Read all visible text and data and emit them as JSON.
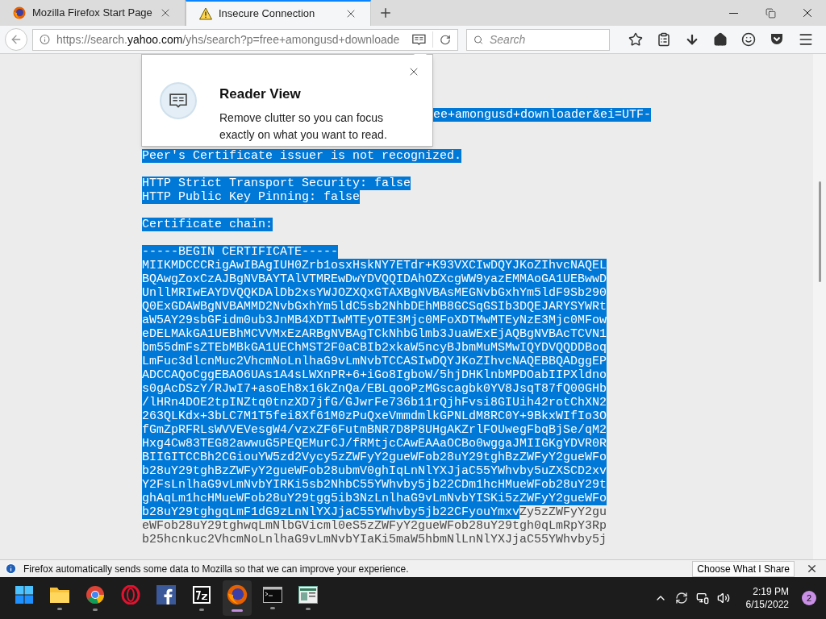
{
  "tabs": [
    {
      "title": "Mozilla Firefox Start Page",
      "kind": "firefox",
      "selected": false
    },
    {
      "title": "Insecure Connection",
      "kind": "warning",
      "selected": true
    }
  ],
  "address_bar": {
    "url_prefix": "https://search.",
    "url_domain": "yahoo.com",
    "url_rest": "/yhs/search?p=free+amongusd+downloade"
  },
  "search": {
    "placeholder": "Search"
  },
  "reader_view_popup": {
    "title": "Reader View",
    "text": "Remove clutter so you can focus exactly on what you want to read."
  },
  "page": {
    "lines": [
      {
        "kind": "tail",
        "parts": [
          {
            "text": "ee+amongusd+downloader&ei=UTF-",
            "selected": true
          }
        ]
      },
      {
        "kind": "blank"
      },
      {
        "kind": "blank"
      },
      {
        "kind": "text",
        "parts": [
          {
            "text": "Peer's Certificate issuer is not recognized.",
            "selected": true
          }
        ]
      },
      {
        "kind": "blank"
      },
      {
        "kind": "text",
        "parts": [
          {
            "text": "HTTP Strict Transport Security: false",
            "selected": true
          }
        ]
      },
      {
        "kind": "text",
        "parts": [
          {
            "text": "HTTP Public Key Pinning: false",
            "selected": true
          }
        ]
      },
      {
        "kind": "blank"
      },
      {
        "kind": "text",
        "parts": [
          {
            "text": "Certificate chain:",
            "selected": true
          }
        ]
      },
      {
        "kind": "blank"
      },
      {
        "kind": "text",
        "parts": [
          {
            "text": "-----BEGIN CERTIFICATE-----",
            "selected": true
          }
        ]
      },
      {
        "kind": "text",
        "parts": [
          {
            "text": "MIIKMDCCCRigAwIBAgIUH0Zrb1osxHskNY7ETdr+K93VXCIwDQYJKoZIhvcNAQEL",
            "selected": true
          }
        ]
      },
      {
        "kind": "text",
        "parts": [
          {
            "text": "BQAwgZoxCzAJBgNVBAYTAlVTMREwDwYDVQQIDAhOZXcgWW9yazEMMAoGA1UEBwwD",
            "selected": true
          }
        ]
      },
      {
        "kind": "text",
        "parts": [
          {
            "text": "UnllMRIwEAYDVQQKDAlDb2xsYWJOZXQxGTAXBgNVBAsMEGNvbGxhYm5ldF9Sb290",
            "selected": true
          }
        ]
      },
      {
        "kind": "text",
        "parts": [
          {
            "text": "Q0ExGDAWBgNVBAMMD2NvbGxhYm5ldC5sb2NhbDEhMB8GCSqGSIb3DQEJARYSYWRt",
            "selected": true
          }
        ]
      },
      {
        "kind": "text",
        "parts": [
          {
            "text": "aW5AY29sbGFidm0ub3JnMB4XDTIwMTEyOTE3Mjc0MFoXDTMwMTEyNzE3Mjc0MFow",
            "selected": true
          }
        ]
      },
      {
        "kind": "text",
        "parts": [
          {
            "text": "eDELMAkGA1UEBhMCVVMxEzARBgNVBAgTCkNhbGlmb3JuaWExEjAQBgNVBAcTCVN1",
            "selected": true
          }
        ]
      },
      {
        "kind": "text",
        "parts": [
          {
            "text": "bm55dmFsZTEbMBkGA1UEChMST2F0aCBIb2xkaW5ncyBJbmMuMSMwIQYDVQQDDBoq",
            "selected": true
          }
        ]
      },
      {
        "kind": "text",
        "parts": [
          {
            "text": "LmFuc3dlcnMuc2VhcmNoLnlhaG9vLmNvbTCCASIwDQYJKoZIhvcNAQEBBQADggEP",
            "selected": true
          }
        ]
      },
      {
        "kind": "text",
        "parts": [
          {
            "text": "ADCCAQoCggEBAO6UAs1A4sLWXnPR+6+iGo8IgboW/5hjDHKlnbMPDOabIIPXldno",
            "selected": true
          }
        ]
      },
      {
        "kind": "text",
        "parts": [
          {
            "text": "s0gAcDSzY/RJwI7+asoEh8x16kZnQa/EBLqooPzMGscagbk0YV8JsqT87fQ00GHb",
            "selected": true
          }
        ]
      },
      {
        "kind": "text",
        "parts": [
          {
            "text": "/lHRn4DOE2tpINZtq0tnzXD7jfG/GJwrFe736b11rQjhFvsi8GIUih42rotChXN2",
            "selected": true
          }
        ]
      },
      {
        "kind": "text",
        "parts": [
          {
            "text": "263QLKdx+3bLC7M1T5fei8Xf61M0zPuQxeVmmdmlkGPNLdM8RC0Y+9BkxWIfIo3O",
            "selected": true
          }
        ]
      },
      {
        "kind": "text",
        "parts": [
          {
            "text": "fGmZpRFRLsWVVEVesgW4/vzxZF6FutmBNR7D8P8UHgAKZrlFOUwegFbqBjSe/qM2",
            "selected": true
          }
        ]
      },
      {
        "kind": "text",
        "parts": [
          {
            "text": "Hxg4Cw83TEG82awwuG5PEQEMurCJ/fRMtjcCAwEAAaOCBo0wggaJMIIGKgYDVR0R",
            "selected": true
          }
        ]
      },
      {
        "kind": "text",
        "parts": [
          {
            "text": "BIIGITCCBh2CGiouYW5zd2Vycy5zZWFyY2gueWFob28uY29tghBzZWFyY2gueWFo",
            "selected": true
          }
        ]
      },
      {
        "kind": "text",
        "parts": [
          {
            "text": "b28uY29tghBzZWFyY2gueWFob28ubmV0ghIqLnNlYXJjaC55YWhvby5uZXSCD2xv",
            "selected": true
          }
        ]
      },
      {
        "kind": "text",
        "parts": [
          {
            "text": "Y2FsLnlhaG9vLmNvbYIRKi5sb2NhbC55YWhvby5jb22CDm1hcHMueWFob28uY29t",
            "selected": true
          }
        ]
      },
      {
        "kind": "text",
        "parts": [
          {
            "text": "ghAqLm1hcHMueWFob28uY29tgg5ib3NzLnlhaG9vLmNvbYISKi5zZWFyY2gueWFo",
            "selected": true
          }
        ]
      },
      {
        "kind": "text",
        "parts": [
          {
            "text": "b28uY29tghgqLmF1dG9zLnNlYXJjaC55YWhvby5jb22CFyouYmxv",
            "selected": true
          },
          {
            "text": "Zy5zZWFyY2gu",
            "selected": false
          }
        ]
      },
      {
        "kind": "text",
        "parts": [
          {
            "text": "eWFob28uY29tghwqLmNlbGVicml0eS5zZWFyY2gueWFob28uY29tgh0qLmRpY3Rp",
            "selected": false
          }
        ]
      },
      {
        "kind": "text",
        "parts": [
          {
            "text": "b25hcnkuc2VhcmNoLnlhaG9vLmNvbYIaKi5maW5hbmNlLnNlYXJjaC55YWhvby5j",
            "selected": false
          }
        ]
      }
    ]
  },
  "notification": {
    "text": "Firefox automatically sends some data to Mozilla so that we can improve your experience.",
    "button": "Choose What I Share"
  },
  "taskbar": {
    "apps": [
      {
        "kind": "start",
        "running": false,
        "selected": false
      },
      {
        "kind": "folder",
        "running": true,
        "selected": false
      },
      {
        "kind": "chrome",
        "running": true,
        "selected": false
      },
      {
        "kind": "opera",
        "running": false,
        "selected": false
      },
      {
        "kind": "facebook",
        "running": false,
        "selected": false
      },
      {
        "kind": "sevenzip",
        "running": true,
        "selected": false
      },
      {
        "kind": "firefox",
        "running": true,
        "selected": true
      },
      {
        "kind": "terminal",
        "running": true,
        "selected": false
      },
      {
        "kind": "viewer",
        "running": true,
        "selected": false
      }
    ],
    "time": "2:19 PM",
    "date": "6/15/2022",
    "notification_count": "2"
  }
}
